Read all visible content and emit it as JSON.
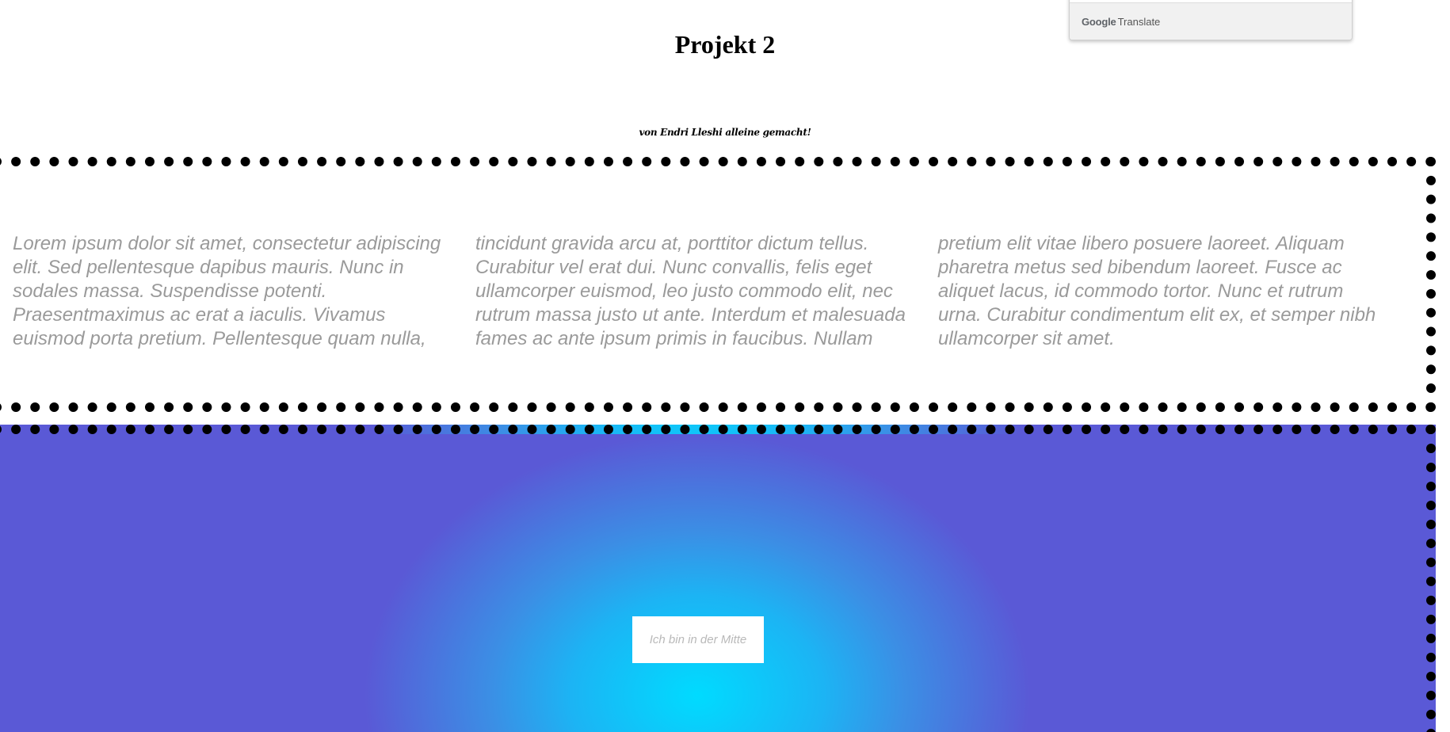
{
  "translate_widget": {
    "brand": "Google",
    "label": "Translate"
  },
  "header": {
    "title": "Projekt 2",
    "subtitle": "von Endri Lleshi alleine gemacht!"
  },
  "text_section": {
    "columns": [
      "Lorem ipsum dolor sit amet, consectetur adipiscing elit. Sed pellentesque dapibus mauris. Nunc in sodales massa. Suspendisse potenti. Praesentmaximus ac erat a iaculis. Vivamus euismod porta pretium. Pellentesque quam nulla,",
      "tincidunt gravida arcu at, porttitor dictum tellus. Curabitur vel erat dui. Nunc convallis, felis eget ullamcorper euismod, leo justo commodo elit, nec rutrum massa justo ut ante. Interdum et malesuada fames ac ante ipsum primis in faucibus. Nullam",
      "pretium elit vitae libero posuere laoreet. Aliquam pharetra metus sed bibendum laoreet. Fusce ac aliquet lacus, id commodo tortor. Nunc et rutrum urna. Curabitur condimentum elit ex, et semper nibh ullamcorper sit amet."
    ],
    "text_color": "#9a9a9a"
  },
  "gradient_section": {
    "center_text": "Ich bin in der Mitte",
    "colors": {
      "center": "#00dbff",
      "edge": "#5a59d6"
    }
  }
}
